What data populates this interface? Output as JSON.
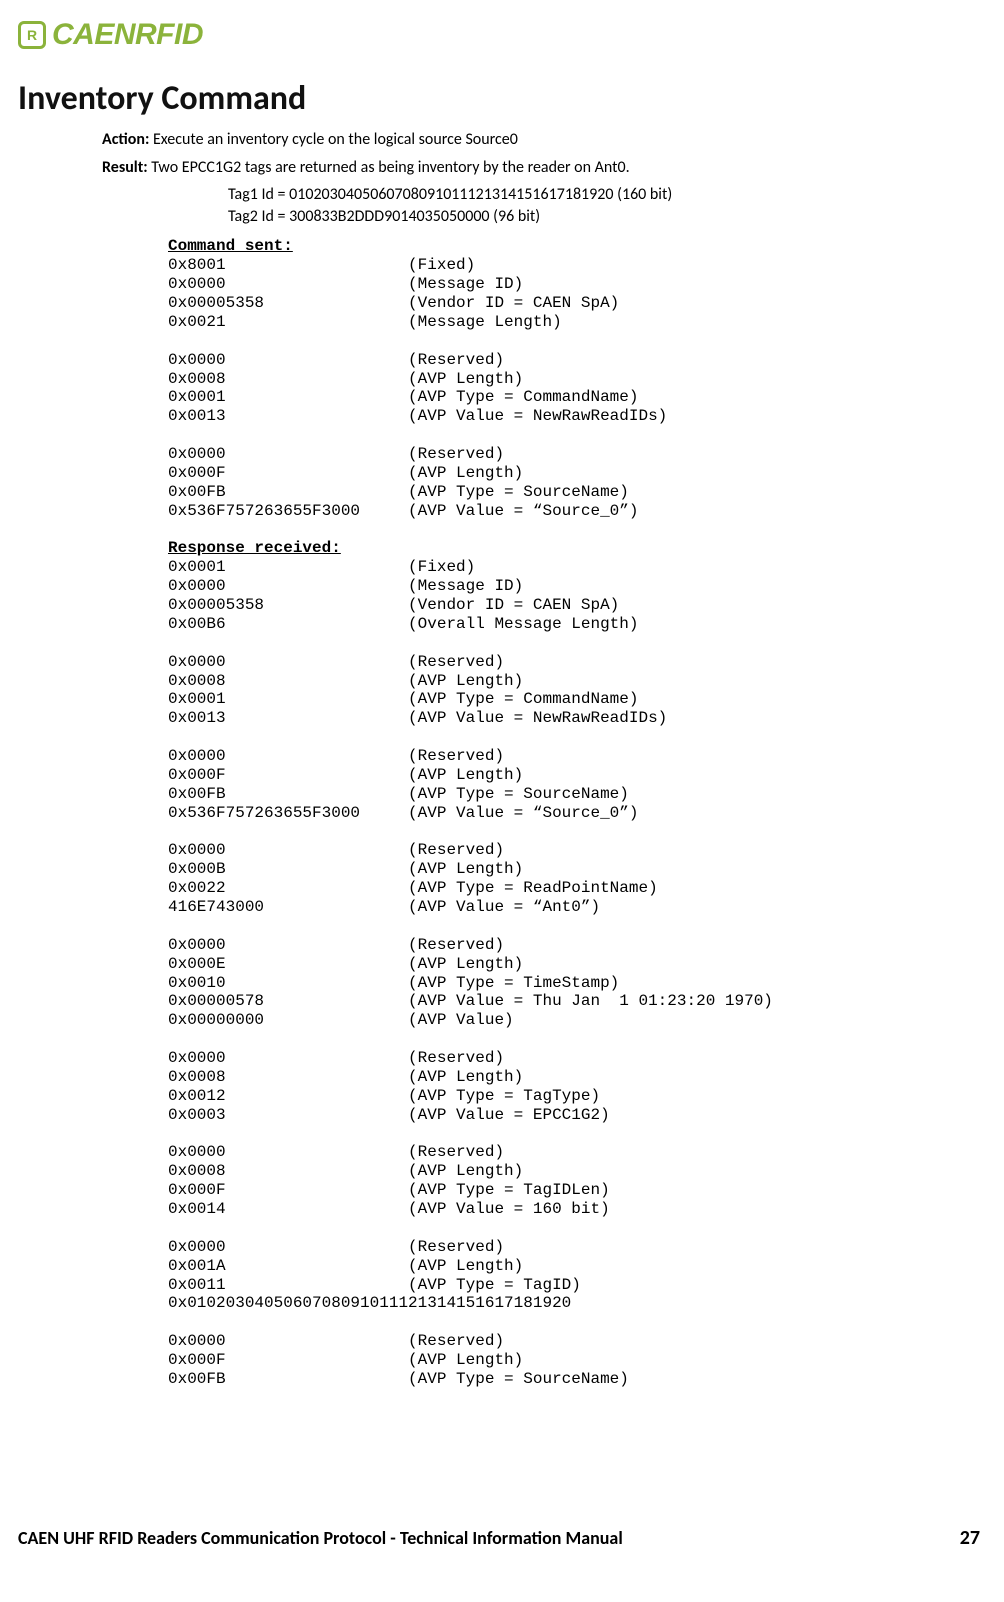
{
  "logo_text": "CAENRFID",
  "title": "Inventory Command",
  "action_label": "Action:",
  "action_text": " Execute an inventory cycle on the logical source Source0",
  "result_label": "Result:",
  "result_text": " Two EPCC1G2 tags are returned as being inventory by the reader on Ant0.",
  "tag1": "Tag1 Id = 0102030405060708091011121314151617181920 (160 bit)",
  "tag2": "Tag2  Id =  300833B2DDD9014035050000 (96 bit)",
  "command_sent_header": "Command sent:",
  "command_sent": [
    [
      "0x8001",
      "(Fixed)"
    ],
    [
      "0x0000",
      "(Message ID)"
    ],
    [
      "0x00005358",
      "(Vendor ID = CAEN SpA)"
    ],
    [
      "0x0021",
      "(Message Length)"
    ],
    [
      "",
      ""
    ],
    [
      "0x0000",
      "(Reserved)"
    ],
    [
      "0x0008",
      "(AVP Length)"
    ],
    [
      "0x0001",
      "(AVP Type = CommandName)"
    ],
    [
      "0x0013",
      "(AVP Value = NewRawReadIDs)"
    ],
    [
      "",
      ""
    ],
    [
      "0x0000",
      "(Reserved)"
    ],
    [
      "0x000F",
      "(AVP Length)"
    ],
    [
      "0x00FB",
      "(AVP Type = SourceName)"
    ],
    [
      "0x536F757263655F3000",
      "(AVP Value = “Source_0”)"
    ]
  ],
  "response_header": "Response received:",
  "response": [
    [
      "0x0001",
      "(Fixed)"
    ],
    [
      "0x0000",
      "(Message ID)"
    ],
    [
      "0x00005358",
      "(Vendor ID = CAEN SpA)"
    ],
    [
      "0x00B6",
      "(Overall Message Length)"
    ],
    [
      "",
      ""
    ],
    [
      "0x0000",
      "(Reserved)"
    ],
    [
      "0x0008",
      "(AVP Length)"
    ],
    [
      "0x0001",
      "(AVP Type = CommandName)"
    ],
    [
      "0x0013",
      "(AVP Value = NewRawReadIDs)"
    ],
    [
      "",
      ""
    ],
    [
      "0x0000",
      "(Reserved)"
    ],
    [
      "0x000F",
      "(AVP Length)"
    ],
    [
      "0x00FB",
      "(AVP Type = SourceName)"
    ],
    [
      "0x536F757263655F3000",
      "(AVP Value = “Source_0”)"
    ],
    [
      "",
      ""
    ],
    [
      "0x0000",
      "(Reserved)"
    ],
    [
      "0x000B",
      "(AVP Length)"
    ],
    [
      "0x0022",
      "(AVP Type = ReadPointName)"
    ],
    [
      "416E743000",
      "(AVP Value = “Ant0”)"
    ],
    [
      "",
      ""
    ],
    [
      "0x0000",
      "(Reserved)"
    ],
    [
      "0x000E",
      "(AVP Length)"
    ],
    [
      "0x0010",
      "(AVP Type = TimeStamp)"
    ],
    [
      "0x00000578",
      "(AVP Value = Thu Jan  1 01:23:20 1970)"
    ],
    [
      "0x00000000",
      "(AVP Value)"
    ],
    [
      "",
      ""
    ],
    [
      "0x0000",
      "(Reserved)"
    ],
    [
      "0x0008",
      "(AVP Length)"
    ],
    [
      "0x0012",
      "(AVP Type = TagType)"
    ],
    [
      "0x0003",
      "(AVP Value = EPCC1G2)"
    ],
    [
      "",
      ""
    ],
    [
      "0x0000",
      "(Reserved)"
    ],
    [
      "0x0008",
      "(AVP Length)"
    ],
    [
      "0x000F",
      "(AVP Type = TagIDLen)"
    ],
    [
      "0x0014",
      "(AVP Value = 160 bit)"
    ],
    [
      "",
      ""
    ],
    [
      "0x0000",
      "(Reserved)"
    ],
    [
      "0x001A",
      "(AVP Length)"
    ],
    [
      "0x0011",
      "(AVP Type = TagID)"
    ],
    [
      "0x0102030405060708091011121314151617181920",
      ""
    ],
    [
      "",
      ""
    ],
    [
      "0x0000",
      "(Reserved)"
    ],
    [
      "0x000F",
      "(AVP Length)"
    ],
    [
      "0x00FB",
      "(AVP Type = SourceName)"
    ]
  ],
  "footer_title": "CAEN UHF RFID Readers Communication Protocol - Technical Information Manual",
  "footer_page": "27"
}
